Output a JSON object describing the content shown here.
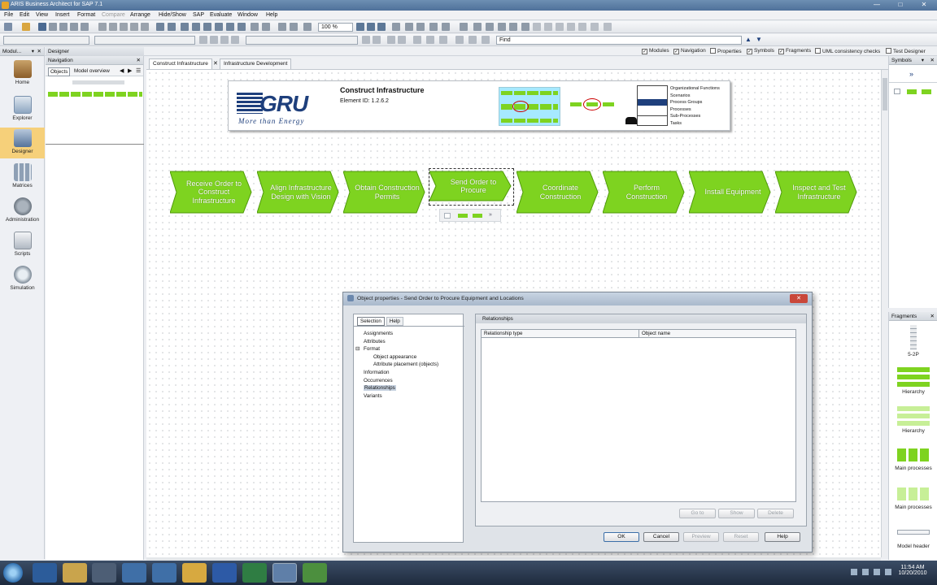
{
  "window": {
    "title": "ARIS Business Architect for SAP 7.1"
  },
  "menu": [
    "File",
    "Edit",
    "View",
    "Insert",
    "Format",
    "Compare",
    "Arrange",
    "Hide/Show",
    "SAP",
    "Evaluate",
    "Window",
    "Help"
  ],
  "toolbar": {
    "zoom": "100 %",
    "find_placeholder": "Find"
  },
  "view_options": [
    {
      "label": "Modules",
      "checked": true
    },
    {
      "label": "Navigation",
      "checked": true
    },
    {
      "label": "Properties",
      "checked": false
    },
    {
      "label": "Symbols",
      "checked": true
    },
    {
      "label": "Fragments",
      "checked": true
    },
    {
      "label": "UML consistency checks",
      "checked": false
    },
    {
      "label": "Test Designer",
      "checked": false
    }
  ],
  "modules": {
    "header": "Modul...",
    "items": [
      {
        "label": "Home",
        "icon": "home-icon"
      },
      {
        "label": "Explorer",
        "icon": "explorer-icon"
      },
      {
        "label": "Designer",
        "icon": "designer-icon",
        "active": true
      },
      {
        "label": "Matrices",
        "icon": "matrix-icon"
      },
      {
        "label": "Administration",
        "icon": "gears-icon"
      },
      {
        "label": "Scripts",
        "icon": "script-icon"
      },
      {
        "label": "Simulation",
        "icon": "simulation-icon"
      }
    ]
  },
  "designer_label": "Designer",
  "navigation": {
    "header": "Navigation",
    "tabs": [
      "Objects",
      "Model overview"
    ]
  },
  "tabs": [
    "Construct Infrastructure",
    "Infrastructure Development"
  ],
  "model_header": {
    "logo_text": "GRU",
    "logo_tagline": "More than Energy",
    "title": "Construct Infrastructure",
    "element_id": "Element ID: 1.2.6.2",
    "legend": [
      "Organizational Functions",
      "Scenarios",
      "Process Groups",
      "Processes",
      "Sub-Processes",
      "Tasks"
    ]
  },
  "processes": [
    "Receive Order to Construct Infrastructure",
    "Align Infrastructure Design with Vision",
    "Obtain Construction Permits",
    "Send Order to Procure",
    "Coordinate Construction",
    "Perform Construction",
    "Install Equipment",
    "Inspect and Test Infrastructure"
  ],
  "dialog": {
    "title": "Object properties - Send Order to Procure Equipment and Locations",
    "tabs": [
      "Selection",
      "Help"
    ],
    "tree": [
      {
        "label": "Assignments",
        "level": 0
      },
      {
        "label": "Attributes",
        "level": 0
      },
      {
        "label": "Format",
        "level": 0
      },
      {
        "label": "Object appearance",
        "level": 1
      },
      {
        "label": "Attribute placement (objects)",
        "level": 1
      },
      {
        "label": "Information",
        "level": 0
      },
      {
        "label": "Occurrences",
        "level": 0
      },
      {
        "label": "Relationships",
        "level": 0,
        "selected": true
      },
      {
        "label": "Variants",
        "level": 0
      }
    ],
    "section": "Relationships",
    "columns": [
      "Relationship type",
      "Object name"
    ],
    "inner_buttons": [
      "Go to",
      "Show",
      "Delete"
    ],
    "buttons": [
      "OK",
      "Cancel",
      "Preview",
      "Reset",
      "Help"
    ]
  },
  "symbols": {
    "header": "Symbols"
  },
  "fragments": {
    "header": "Fragments",
    "items": [
      "5-2P",
      "Hierarchy",
      "Hierarchy",
      "Main processes",
      "Main processes",
      "Model header"
    ]
  },
  "clock": {
    "time": "11:54 AM",
    "date": "10/20/2010"
  },
  "colors": {
    "process_green": "#7ed320",
    "accent_blue": "#1e3f7c",
    "selection": "#f6d07a"
  }
}
